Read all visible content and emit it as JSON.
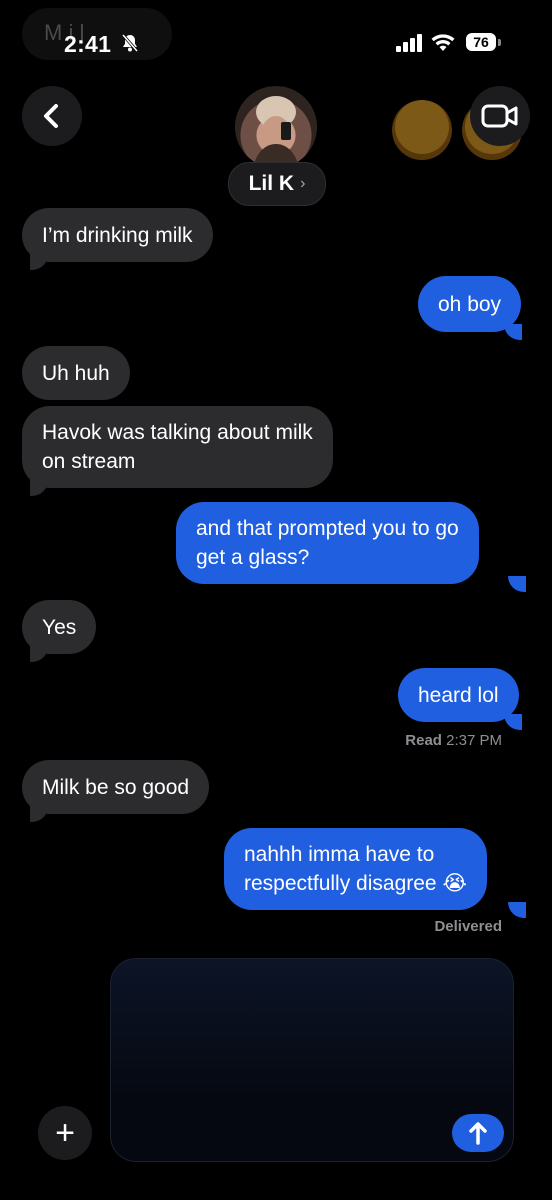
{
  "status_bar": {
    "time": "2:41",
    "ghost_text": "M  i  l",
    "battery": "76"
  },
  "header": {
    "contact_name": "Lil K",
    "contact_chevron": "›"
  },
  "messages": [
    {
      "dir": "in",
      "text": "I’m drinking milk"
    },
    {
      "dir": "out",
      "text": "oh boy"
    },
    {
      "dir": "in",
      "text": "Uh huh"
    },
    {
      "dir": "in",
      "line1": "Havok was talking about milk",
      "line2": "on stream"
    },
    {
      "dir": "out",
      "line1": "and that prompted you to go",
      "line2": "get a glass?"
    },
    {
      "dir": "in",
      "text": "Yes"
    },
    {
      "dir": "out",
      "text": "heard lol"
    },
    {
      "dir": "in",
      "text": "Milk be so good"
    },
    {
      "dir": "out",
      "line1": "nahhh imma have to",
      "line2": "respectfully disagree",
      "emoji": "😭"
    }
  ],
  "receipts": {
    "read_label": "Read",
    "read_time": "2:37 PM",
    "delivered": "Delivered"
  },
  "composer": {
    "plus": "+"
  },
  "colors": {
    "outgoing": "#1f5fe0",
    "incoming": "#2c2c2e",
    "background": "#000000"
  }
}
